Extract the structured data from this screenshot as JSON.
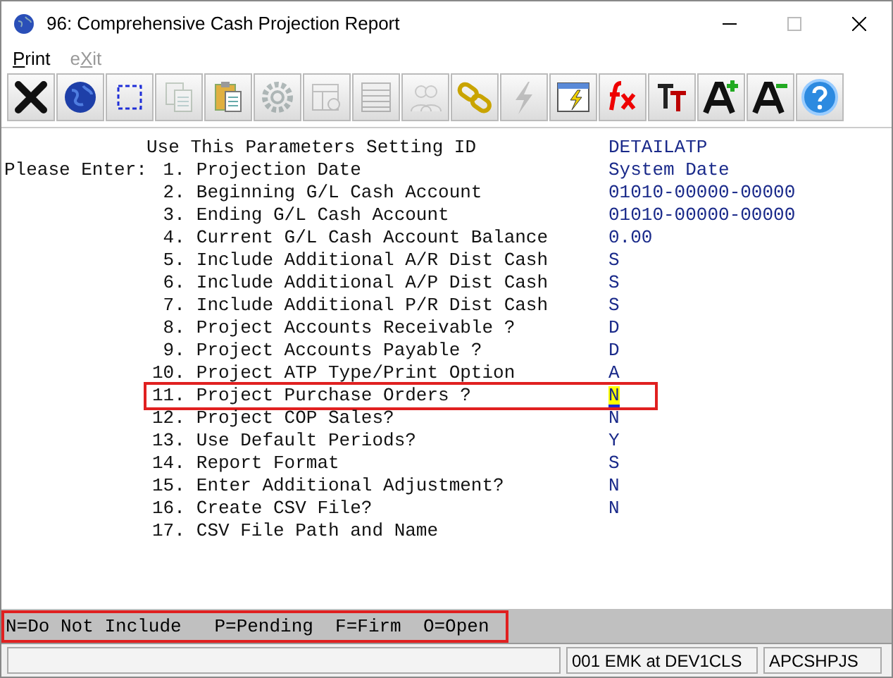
{
  "window": {
    "title": "96: Comprehensive Cash Projection Report"
  },
  "menu": [
    {
      "key": "P",
      "after": "rint",
      "disabled": false
    },
    {
      "before": "e",
      "key": "X",
      "after": "it",
      "disabled": true
    }
  ],
  "toolbar": [
    {
      "kind": "close",
      "disabled": false
    },
    {
      "kind": "globe",
      "disabled": false
    },
    {
      "kind": "select",
      "disabled": false
    },
    {
      "kind": "copy",
      "disabled": true
    },
    {
      "kind": "paste",
      "disabled": false
    },
    {
      "kind": "gear",
      "disabled": true
    },
    {
      "kind": "form",
      "disabled": true
    },
    {
      "kind": "list",
      "disabled": true
    },
    {
      "kind": "people",
      "disabled": true
    },
    {
      "kind": "chain",
      "disabled": false
    },
    {
      "kind": "bolt",
      "disabled": true
    },
    {
      "kind": "report",
      "disabled": false
    },
    {
      "kind": "fx",
      "disabled": false
    },
    {
      "kind": "font",
      "disabled": false
    },
    {
      "kind": "grow",
      "disabled": false
    },
    {
      "kind": "shrink",
      "disabled": false
    },
    {
      "kind": "help",
      "disabled": false
    }
  ],
  "form": {
    "prompt": "Please Enter:",
    "header": {
      "label": "Use This Parameters Setting ID",
      "value": "DETAILATP"
    },
    "rows": [
      {
        "number": "1.",
        "label": "Projection Date",
        "value": "System Date",
        "highlighted": false,
        "current": false
      },
      {
        "number": "2.",
        "label": "Beginning G/L Cash Account",
        "value": "01010-00000-00000",
        "highlighted": false,
        "current": false
      },
      {
        "number": "3.",
        "label": "Ending G/L Cash Account",
        "value": "01010-00000-00000",
        "highlighted": false,
        "current": false
      },
      {
        "number": "4.",
        "label": "Current G/L Cash Account Balance",
        "value": "0.00",
        "highlighted": false,
        "current": false
      },
      {
        "number": "5.",
        "label": "Include Additional A/R Dist Cash",
        "value": "S",
        "highlighted": false,
        "current": false
      },
      {
        "number": "6.",
        "label": "Include Additional A/P Dist Cash",
        "value": "S",
        "highlighted": false,
        "current": false
      },
      {
        "number": "7.",
        "label": "Include Additional P/R Dist Cash",
        "value": "S",
        "highlighted": false,
        "current": false
      },
      {
        "number": "8.",
        "label": "Project Accounts Receivable ?",
        "value": "D",
        "highlighted": false,
        "current": false
      },
      {
        "number": "9.",
        "label": "Project Accounts Payable ?",
        "value": "D",
        "highlighted": false,
        "current": false
      },
      {
        "number": "10.",
        "label": "Project ATP Type/Print Option",
        "value": "A",
        "highlighted": false,
        "current": false
      },
      {
        "number": "11.",
        "label": "Project Purchase Orders ?",
        "value": "N",
        "highlighted": true,
        "current": true
      },
      {
        "number": "12.",
        "label": "Project COP Sales?",
        "value": "N",
        "highlighted": false,
        "current": false
      },
      {
        "number": "13.",
        "label": "Use Default Periods?",
        "value": "Y",
        "highlighted": false,
        "current": false
      },
      {
        "number": "14.",
        "label": "Report Format",
        "value": "S",
        "highlighted": false,
        "current": false
      },
      {
        "number": "15.",
        "label": "Enter Additional Adjustment?",
        "value": "N",
        "highlighted": false,
        "current": false
      },
      {
        "number": "16.",
        "label": "Create CSV File?",
        "value": "N",
        "highlighted": false,
        "current": false
      },
      {
        "number": "17.",
        "label": "CSV File Path and Name",
        "highlighted": false,
        "current": false
      }
    ]
  },
  "hint_bar": {
    "text": "N=Do Not Include   P=Pending  F=Firm  O=Open",
    "highlighted": true
  },
  "status_bar": {
    "user": "001 EMK at DEV1CLS",
    "program": "APCSHPJS"
  }
}
